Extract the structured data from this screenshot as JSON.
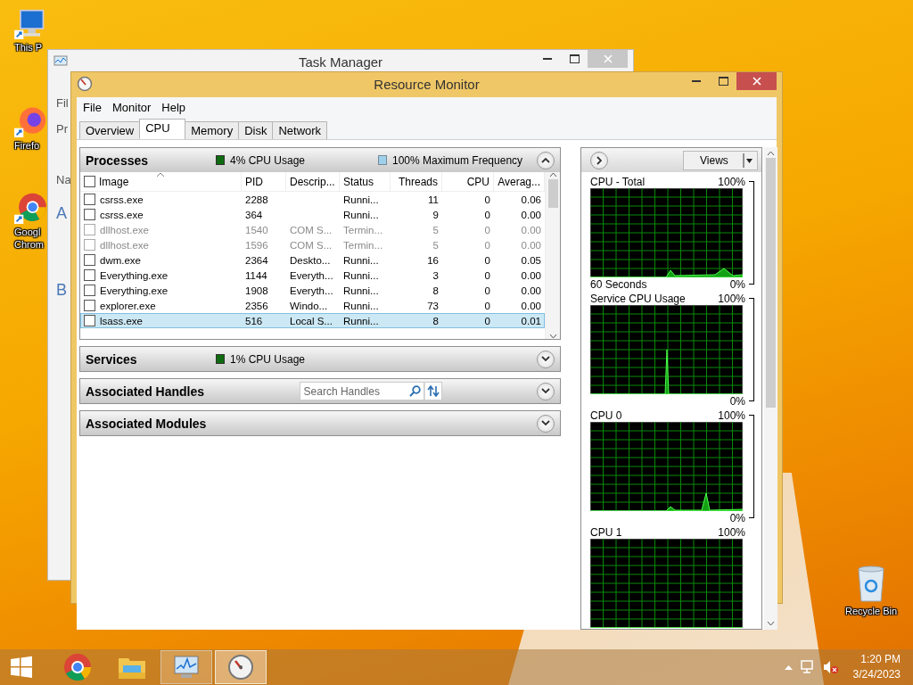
{
  "desktop": {
    "icons": [
      {
        "kind": "computer",
        "label": "This P"
      },
      {
        "kind": "firefox",
        "label": "Firefo"
      },
      {
        "kind": "chrome",
        "label": "Googl Chrom"
      }
    ],
    "recycle_bin": {
      "label": "Recycle Bin"
    }
  },
  "task_manager": {
    "title": "Task Manager",
    "fragments": [
      "Fil",
      "Pr",
      "Na",
      "A",
      "B"
    ]
  },
  "resource_monitor": {
    "title": "Resource Monitor",
    "menu": [
      "File",
      "Monitor",
      "Help"
    ],
    "tabs": [
      {
        "label": "Overview",
        "selected": false
      },
      {
        "label": "CPU",
        "selected": true
      },
      {
        "label": "Memory",
        "selected": false
      },
      {
        "label": "Disk",
        "selected": false
      },
      {
        "label": "Network",
        "selected": false
      }
    ],
    "processes": {
      "title": "Processes",
      "usage": "4% CPU Usage",
      "frequency": "100% Maximum Frequency",
      "expanded": true,
      "all_checked": false,
      "columns": [
        "Image",
        "PID",
        "Descrip...",
        "Status",
        "Threads",
        "CPU",
        "Averag..."
      ],
      "rows": [
        {
          "cells": [
            "csrss.exe",
            "2288",
            "",
            "Runni...",
            "11",
            "0",
            "0.06"
          ],
          "checked": false,
          "terminated": false,
          "selected": false
        },
        {
          "cells": [
            "csrss.exe",
            "364",
            "",
            "Runni...",
            "9",
            "0",
            "0.00"
          ],
          "checked": false,
          "terminated": false,
          "selected": false
        },
        {
          "cells": [
            "dllhost.exe",
            "1540",
            "COM S...",
            "Termin...",
            "5",
            "0",
            "0.00"
          ],
          "checked": false,
          "terminated": true,
          "selected": false
        },
        {
          "cells": [
            "dllhost.exe",
            "1596",
            "COM S...",
            "Termin...",
            "5",
            "0",
            "0.00"
          ],
          "checked": false,
          "terminated": true,
          "selected": false
        },
        {
          "cells": [
            "dwm.exe",
            "2364",
            "Deskto...",
            "Runni...",
            "16",
            "0",
            "0.05"
          ],
          "checked": false,
          "terminated": false,
          "selected": false
        },
        {
          "cells": [
            "Everything.exe",
            "1144",
            "Everyth...",
            "Runni...",
            "3",
            "0",
            "0.00"
          ],
          "checked": false,
          "terminated": false,
          "selected": false
        },
        {
          "cells": [
            "Everything.exe",
            "1908",
            "Everyth...",
            "Runni...",
            "8",
            "0",
            "0.00"
          ],
          "checked": false,
          "terminated": false,
          "selected": false
        },
        {
          "cells": [
            "explorer.exe",
            "2356",
            "Windo...",
            "Runni...",
            "73",
            "0",
            "0.00"
          ],
          "checked": false,
          "terminated": false,
          "selected": false
        },
        {
          "cells": [
            "lsass.exe",
            "516",
            "Local S...",
            "Runni...",
            "8",
            "0",
            "0.01"
          ],
          "checked": false,
          "terminated": false,
          "selected": true
        }
      ]
    },
    "sections": [
      {
        "kind": "usage",
        "title": "Services",
        "usage": "1% CPU Usage",
        "expanded": false
      },
      {
        "kind": "search",
        "title": "Associated Handles",
        "placeholder": "Search Handles",
        "expanded": false
      },
      {
        "kind": "plain",
        "title": "Associated Modules",
        "expanded": false
      }
    ],
    "views_button": "Views",
    "graphs": [
      {
        "title": "CPU - Total",
        "max": "100%",
        "footer": "60 Seconds",
        "min": "0%"
      },
      {
        "title": "Service CPU Usage",
        "max": "100%",
        "min": "0%"
      },
      {
        "title": "CPU 0",
        "max": "100%",
        "min": "0%"
      },
      {
        "title": "CPU 1",
        "max": "100%"
      }
    ]
  },
  "taskbar": {
    "apps": [
      {
        "kind": "chrome",
        "running": false,
        "selected": false
      },
      {
        "kind": "explorer",
        "running": false,
        "selected": false
      },
      {
        "kind": "taskmanager",
        "running": true,
        "selected": false
      },
      {
        "kind": "resmon",
        "running": true,
        "selected": true
      }
    ],
    "time": "1:20 PM",
    "date": "3/24/2023"
  }
}
